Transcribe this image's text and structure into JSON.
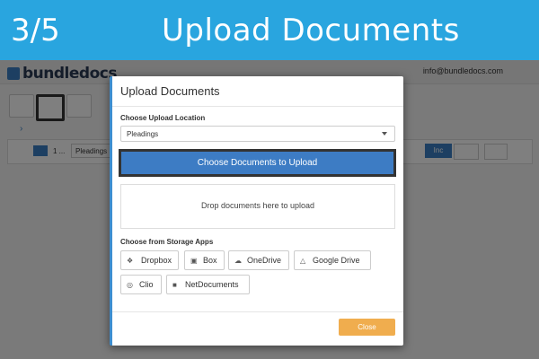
{
  "banner": {
    "step": "3/5",
    "title": "Upload Documents"
  },
  "app": {
    "logo": "bundledocs",
    "user_email": "info@bundledocs.com",
    "chevron": "›",
    "row": {
      "name": "1 ...",
      "location": "Pleadings",
      "inc": "Inc"
    }
  },
  "modal": {
    "title": "Upload Documents",
    "location_label": "Choose Upload Location",
    "location_value": "Pleadings",
    "choose_button": "Choose Documents to Upload",
    "drop_text": "Drop documents here to upload",
    "storage_label": "Choose from Storage Apps",
    "storage_apps": [
      "Dropbox",
      "Box",
      "OneDrive",
      "Google Drive",
      "Clio",
      "NetDocuments"
    ],
    "close_button": "Close"
  },
  "colors": {
    "banner": "#29a5df",
    "primary_button": "#3d7cc4",
    "close_button": "#f0ad4e"
  }
}
